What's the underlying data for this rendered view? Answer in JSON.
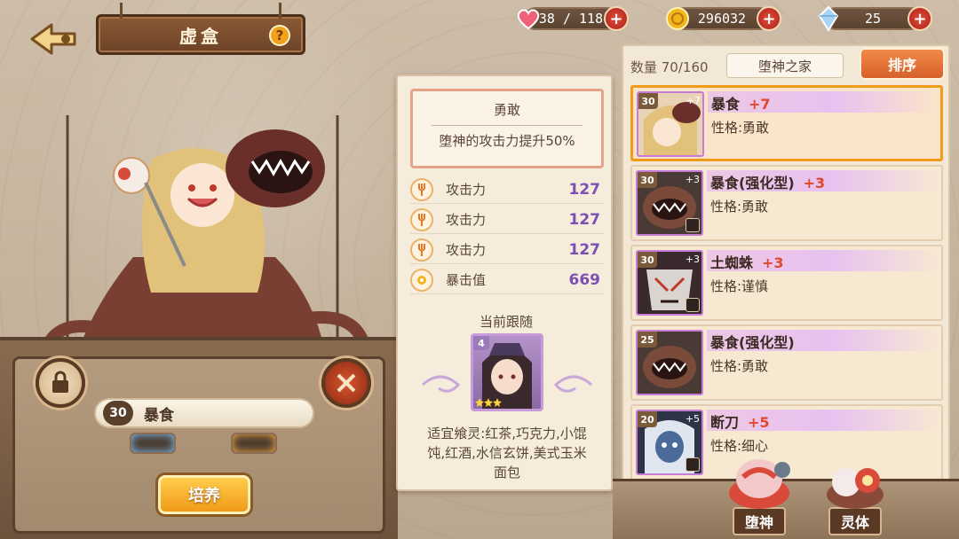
{
  "header": {
    "title": "虚盒",
    "help_glyph": "?",
    "back_icon": "back-arrow-icon"
  },
  "resources": [
    {
      "name": "stamina",
      "icon": "heart-icon",
      "value": "38 / 118",
      "plus": "+"
    },
    {
      "name": "gold",
      "icon": "coin-icon",
      "value": "296032",
      "plus": "+"
    },
    {
      "name": "crystal",
      "icon": "crystal-icon",
      "value": "25",
      "plus": "+"
    }
  ],
  "character": {
    "level": "30",
    "name": "暴食",
    "train_label": "培养"
  },
  "detail": {
    "trait_title": "勇敢",
    "trait_desc": "堕神的攻击力提升50%",
    "stats": [
      {
        "label": "攻击力",
        "value": "127",
        "icon": "fork-icon"
      },
      {
        "label": "攻击力",
        "value": "127",
        "icon": "fork-icon"
      },
      {
        "label": "攻击力",
        "value": "127",
        "icon": "fork-icon"
      },
      {
        "label": "暴击值",
        "value": "669",
        "icon": "crit-icon"
      }
    ],
    "follow_label": "当前跟随",
    "follow_level": "4",
    "suitable_feed_lines": [
      "适宜飨灵:红茶,巧克力,小馄",
      "饨,红酒,水信玄饼,美式玉米",
      "面包"
    ]
  },
  "list": {
    "count_text": "数量 70/160",
    "home_tag": "堕神之家",
    "sort_label": "排序",
    "entries": [
      {
        "level": "30",
        "corner_plus": "+7",
        "name": "暴食",
        "plus": "+7",
        "trait": "性格:勇敢",
        "selected": true,
        "portrait_bg": "#e9d3b6"
      },
      {
        "level": "30",
        "corner_plus": "+3",
        "name": "暴食(强化型)",
        "plus": "+3",
        "trait": "性格:勇敢",
        "selected": false,
        "portrait_bg": "#4a3a36"
      },
      {
        "level": "30",
        "corner_plus": "+3",
        "name": "土蜘蛛",
        "plus": "+3",
        "trait": "性格:谨慎",
        "selected": false,
        "portrait_bg": "#3a2a2e"
      },
      {
        "level": "25",
        "corner_plus": "",
        "name": "暴食(强化型)",
        "plus": "",
        "trait": "性格:勇敢",
        "selected": false,
        "portrait_bg": "#4a3a36"
      },
      {
        "level": "20",
        "corner_plus": "+5",
        "name": "断刀",
        "plus": "+5",
        "trait": "性格:细心",
        "selected": false,
        "portrait_bg": "#2e3448"
      }
    ]
  },
  "tabs": [
    {
      "label": "堕神",
      "icon": "fallen-god-icon"
    },
    {
      "label": "灵体",
      "icon": "spirit-icon"
    }
  ],
  "colors": {
    "accent_orange": "#f29a1a",
    "stat_value_purple": "#7b4fb3",
    "plus_red": "#e0482c"
  }
}
